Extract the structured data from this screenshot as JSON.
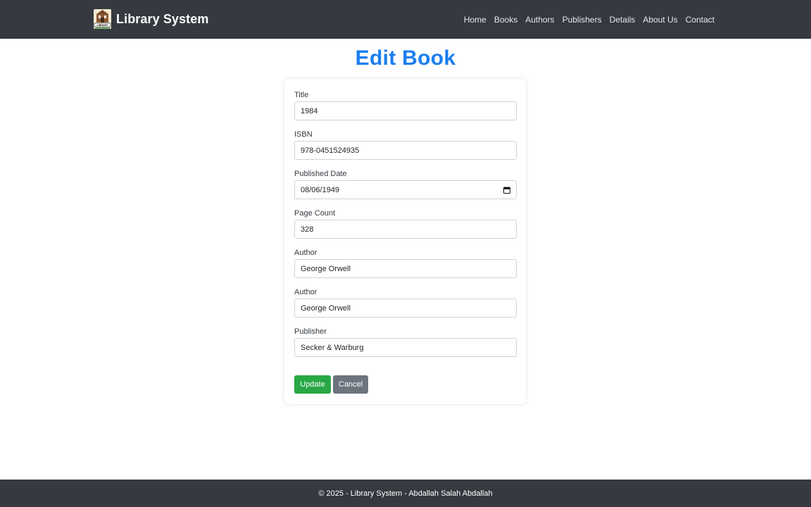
{
  "navbar": {
    "brand_name": "Library System",
    "logo_icon": "library-building-icon",
    "logo_text": "LIBRARY",
    "links": [
      {
        "label": "Home"
      },
      {
        "label": "Books"
      },
      {
        "label": "Authors"
      },
      {
        "label": "Publishers"
      },
      {
        "label": "Details"
      },
      {
        "label": "About Us"
      },
      {
        "label": "Contact"
      }
    ]
  },
  "page": {
    "title": "Edit Book"
  },
  "form": {
    "fields": [
      {
        "label": "Title",
        "value": "1984"
      },
      {
        "label": "ISBN",
        "value": "978-0451524935"
      },
      {
        "label": "Published Date",
        "value": "08/06/1949",
        "icon": "calendar-icon"
      },
      {
        "label": "Page Count",
        "value": "328"
      },
      {
        "label": "Author",
        "value": "George Orwell"
      },
      {
        "label": "Author",
        "value": "George Orwell"
      },
      {
        "label": "Publisher",
        "value": "Secker & Warburg"
      }
    ],
    "update_label": "Update",
    "cancel_label": "Cancel"
  },
  "footer": {
    "text": "© 2025 - Library System - Abdallah Salah Abdallah"
  },
  "colors": {
    "navbar_bg": "#343a40",
    "title_blue": "#1a7ef0",
    "update_green": "#28a745",
    "cancel_gray": "#6c757d"
  }
}
